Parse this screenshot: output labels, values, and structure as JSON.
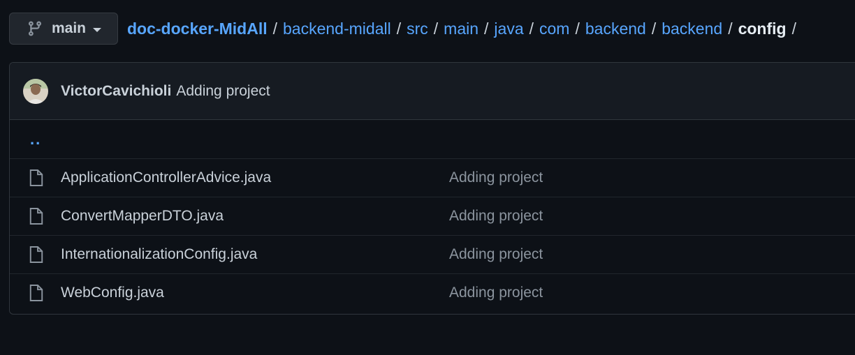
{
  "branch": {
    "label": "main",
    "icon": "git-branch-icon"
  },
  "breadcrumb": {
    "root": "doc-docker-MidAll",
    "parts": [
      "backend-midall",
      "src",
      "main",
      "java",
      "com",
      "backend",
      "backend"
    ],
    "current": "config",
    "separator": "/"
  },
  "commit": {
    "author": "VictorCavichioli",
    "message": "Adding project"
  },
  "parent_link": "..",
  "files": [
    {
      "name": "ApplicationControllerAdvice.java",
      "commit": "Adding project"
    },
    {
      "name": "ConvertMapperDTO.java",
      "commit": "Adding project"
    },
    {
      "name": "InternationalizationConfig.java",
      "commit": "Adding project"
    },
    {
      "name": "WebConfig.java",
      "commit": "Adding project"
    }
  ],
  "colors": {
    "background": "#0d1117",
    "link": "#58a6ff",
    "text": "#c9d1d9",
    "muted": "#8b949e",
    "border": "#30363d"
  }
}
